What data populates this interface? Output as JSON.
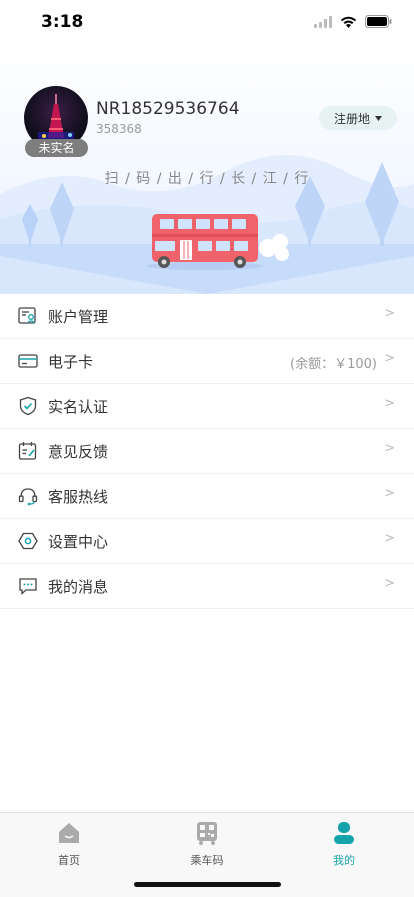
{
  "status_bar": {
    "time": "3:18"
  },
  "profile": {
    "username": "NR18529536764",
    "user_id": "358368",
    "verify_badge": "未实名",
    "region_button": "注册地"
  },
  "banner": {
    "slogan": "扫 / 码 / 出 / 行 / 长 / 江 / 行"
  },
  "menu": [
    {
      "label": "账户管理",
      "icon": "account-card-icon"
    },
    {
      "label": "电子卡",
      "icon": "card-icon",
      "extra": "(余额：￥100)"
    },
    {
      "label": "实名认证",
      "icon": "shield-check-icon"
    },
    {
      "label": "意见反馈",
      "icon": "feedback-calendar-icon"
    },
    {
      "label": "客服热线",
      "icon": "headset-icon"
    },
    {
      "label": "设置中心",
      "icon": "hexagon-settings-icon"
    },
    {
      "label": "我的消息",
      "icon": "chat-icon"
    }
  ],
  "arrow": ">",
  "tabbar": [
    {
      "label": "首页",
      "icon": "home-icon"
    },
    {
      "label": "乘车码",
      "icon": "bus-qr-icon"
    },
    {
      "label": "我的",
      "icon": "person-icon"
    }
  ],
  "colors": {
    "accent": "#16a4ab",
    "bus": "#f0636a",
    "badge": "#7d7d7d"
  }
}
